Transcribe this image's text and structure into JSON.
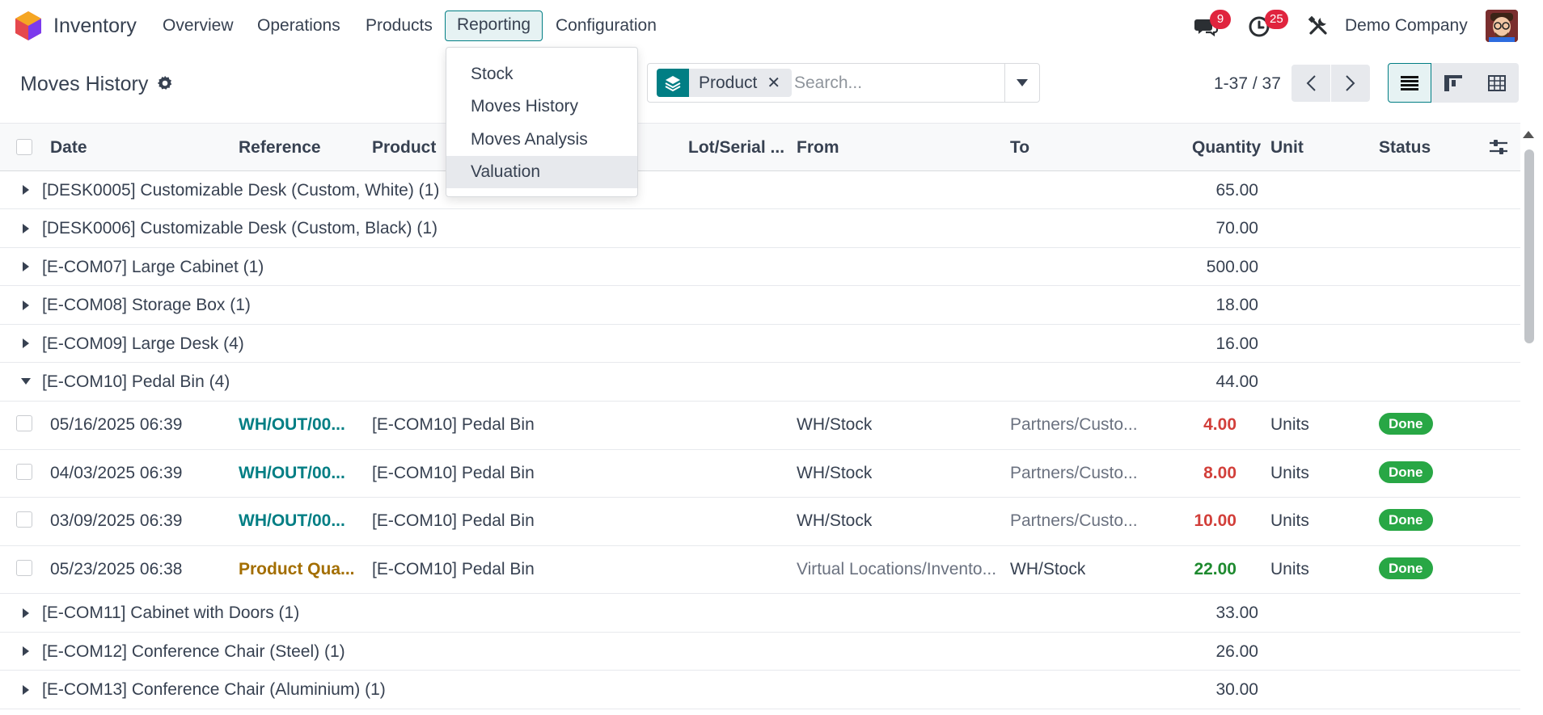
{
  "navbar": {
    "app_name": "Inventory",
    "menu": [
      "Overview",
      "Operations",
      "Products",
      "Reporting",
      "Configuration"
    ],
    "active_menu": "Reporting",
    "messages_badge": "9",
    "activities_badge": "25",
    "company": "Demo Company",
    "icons": {
      "logo": "odoo-inventory-logo",
      "messages": "chat-bubbles-icon",
      "activities": "clock-icon",
      "debug": "tools-icon"
    }
  },
  "control_panel": {
    "title": "Moves History",
    "facet_label": "Product",
    "search_placeholder": "Search...",
    "pager": "1-37 / 37"
  },
  "reporting_menu": {
    "items": [
      "Stock",
      "Moves History",
      "Moves Analysis",
      "Valuation"
    ],
    "highlighted": "Valuation"
  },
  "table": {
    "columns": [
      "Date",
      "Reference",
      "Product",
      "Lot/Serial ...",
      "From",
      "To",
      "Quantity",
      "Unit",
      "Status"
    ],
    "groups_top": [
      {
        "label": "[DESK0005] Customizable Desk (Custom, White) (1)",
        "qty": "65.00"
      },
      {
        "label": "[DESK0006] Customizable Desk (Custom, Black) (1)",
        "qty": "70.00"
      },
      {
        "label": "[E-COM07] Large Cabinet (1)",
        "qty": "500.00"
      },
      {
        "label": "[E-COM08] Storage Box (1)",
        "qty": "18.00"
      },
      {
        "label": "[E-COM09] Large Desk (4)",
        "qty": "16.00"
      },
      {
        "label": "[E-COM10] Pedal Bin (4)",
        "qty": "44.00"
      }
    ],
    "rows": [
      {
        "date": "05/16/2025 06:39",
        "reference": "WH/OUT/00...",
        "product": "[E-COM10] Pedal Bin",
        "from": "WH/Stock",
        "to": "Partners/Custo...",
        "quantity": "4.00",
        "unit": "Units",
        "status": "Done"
      },
      {
        "date": "04/03/2025 06:39",
        "reference": "WH/OUT/00...",
        "product": "[E-COM10] Pedal Bin",
        "from": "WH/Stock",
        "to": "Partners/Custo...",
        "quantity": "8.00",
        "unit": "Units",
        "status": "Done"
      },
      {
        "date": "03/09/2025 06:39",
        "reference": "WH/OUT/00...",
        "product": "[E-COM10] Pedal Bin",
        "from": "WH/Stock",
        "to": "Partners/Custo...",
        "quantity": "10.00",
        "unit": "Units",
        "status": "Done"
      },
      {
        "date": "05/23/2025 06:38",
        "reference": "Product Qua...",
        "product": "[E-COM10] Pedal Bin",
        "from": "Virtual Locations/Invento...",
        "to": "WH/Stock",
        "quantity": "22.00",
        "unit": "Units",
        "status": "Done"
      }
    ],
    "groups_bottom": [
      {
        "label": "[E-COM11] Cabinet with Doors (1)",
        "qty": "33.00"
      },
      {
        "label": "[E-COM12] Conference Chair (Steel) (1)",
        "qty": "26.00"
      },
      {
        "label": "[E-COM13] Conference Chair (Aluminium) (1)",
        "qty": "30.00"
      }
    ]
  },
  "colors": {
    "brand": "#017e84",
    "link": "#017e84",
    "draft_ref": "#a36e00",
    "outgoing_qty": "#d23f3a",
    "incoming_qty": "#28a745",
    "badge": "#e0243e",
    "done": "#28a745"
  }
}
